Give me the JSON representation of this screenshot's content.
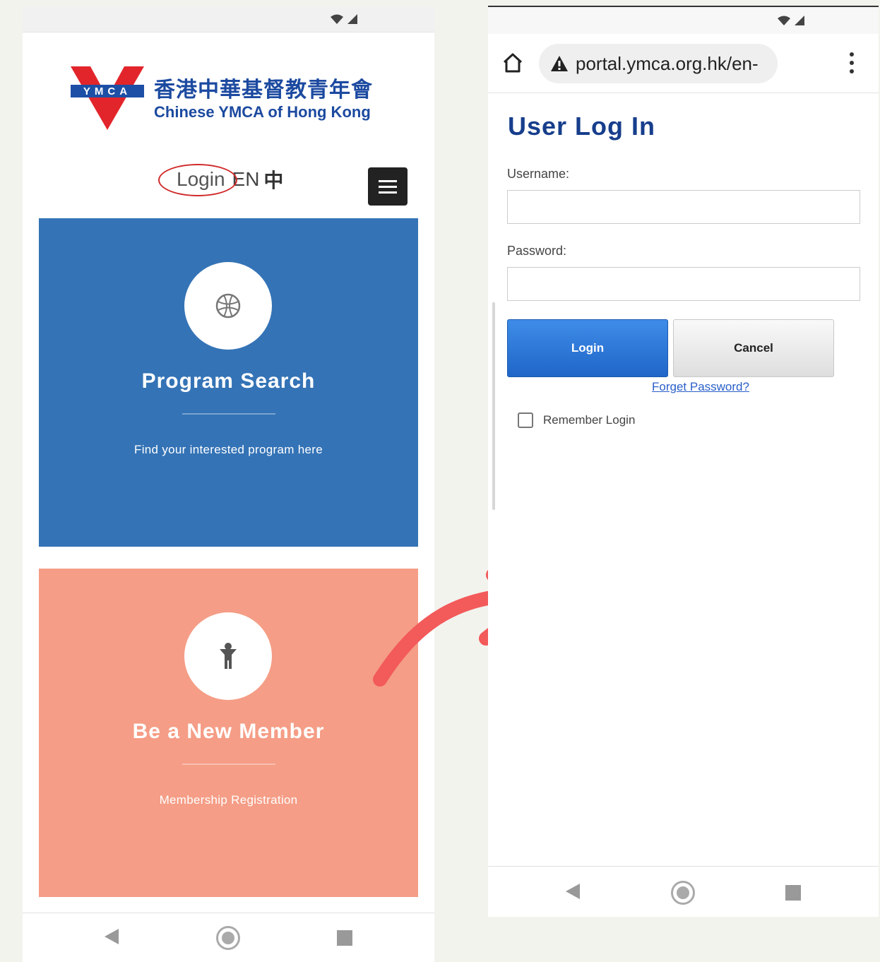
{
  "left_phone": {
    "logo": {
      "badge_text": "YMCA",
      "name_zh": "香港中華基督教青年會",
      "name_en": "Chinese YMCA of Hong Kong"
    },
    "header": {
      "login_label": "Login",
      "lang_en_label": "EN",
      "lang_zh_label": "中"
    },
    "cards": [
      {
        "title": "Program Search",
        "subtitle": "Find your interested program here",
        "icon": "basketball-icon",
        "color": "#3473b6"
      },
      {
        "title": "Be a New Member",
        "subtitle": "Membership Registration",
        "icon": "person-icon",
        "color": "#f59d86"
      }
    ]
  },
  "right_phone": {
    "browser": {
      "url": "portal.ymca.org.hk/en-"
    },
    "form": {
      "title": "User Log In",
      "username_label": "Username:",
      "password_label": "Password:",
      "login_button": "Login",
      "cancel_button": "Cancel",
      "forgot_link": "Forget Password?",
      "remember_label": "Remember Login"
    }
  },
  "colors": {
    "brand_blue": "#1c4aa0",
    "title_blue": "#173e8c",
    "login_button": "#2a76d8",
    "annotation_red": "#f35a5a"
  }
}
